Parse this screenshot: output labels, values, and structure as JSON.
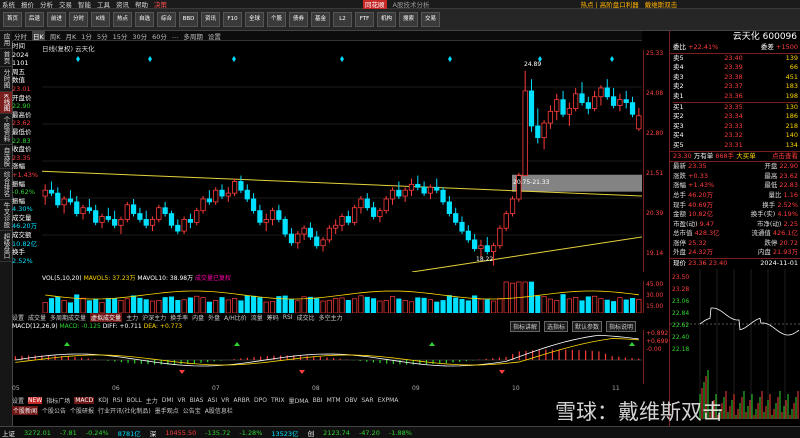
{
  "menu": [
    "系统",
    "报价",
    "分析",
    "交易",
    "智能",
    "工具",
    "资讯",
    "帮助",
    "决策"
  ],
  "app_logo": "同花顺",
  "menu_center": "A股技术分析",
  "menu_right": [
    "热点 | 高阶盘口利器",
    "戴维斯双击"
  ],
  "toolbar": [
    {
      "icon": "home-icon",
      "label": "首页"
    },
    {
      "icon": "back-icon",
      "label": "后退"
    },
    {
      "icon": "forward-icon",
      "label": "前进"
    },
    {
      "icon": "chart-icon",
      "label": "分时"
    },
    {
      "icon": "k-icon",
      "label": "K线"
    },
    {
      "icon": "hot-icon",
      "label": "热点"
    },
    {
      "icon": "select-icon",
      "label": "自选"
    },
    {
      "icon": "rank-icon",
      "label": "综合"
    },
    {
      "icon": "bbd-icon",
      "label": "BBD"
    },
    {
      "icon": "news-icon",
      "label": "资讯"
    },
    {
      "icon": "f10-icon",
      "label": "F10"
    },
    {
      "icon": "global-icon",
      "label": "全球"
    },
    {
      "icon": "stock-icon",
      "label": "个股"
    },
    {
      "icon": "bond-icon",
      "label": "债券"
    },
    {
      "icon": "fund-icon",
      "label": "基金"
    },
    {
      "icon": "level2-icon",
      "label": "L2"
    },
    {
      "icon": "ftf-icon",
      "label": "FTF"
    },
    {
      "icon": "inst-icon",
      "label": "机构"
    },
    {
      "icon": "search-icon",
      "label": "搜索"
    },
    {
      "icon": "trade-icon",
      "label": "交易"
    }
  ],
  "sidebar": [
    {
      "label": "应用",
      "sel": false
    },
    {
      "label": "首页",
      "sel": false
    },
    {
      "label": "分时图",
      "sel": false
    },
    {
      "label": "K线图",
      "sel": true
    },
    {
      "label": "个股资料",
      "sel": false
    },
    {
      "label": "自选股",
      "sel": false
    },
    {
      "label": "综合排名",
      "sel": false
    },
    {
      "label": "牛叉诊股",
      "sel": false
    },
    {
      "label": "超级盘口",
      "sel": false
    }
  ],
  "periods": [
    "分时",
    "日K",
    "周K",
    "月K",
    "1分",
    "5分",
    "15分",
    "30分",
    "60分",
    "…",
    "多周期",
    "设置"
  ],
  "period_selected": "日K",
  "main_title": "日线(复权)  云天化",
  "left_info": [
    {
      "t": "时间",
      "c": "wht"
    },
    {
      "t": "2024",
      "c": "wht"
    },
    {
      "t": "1101",
      "c": "wht"
    },
    {
      "t": "周五",
      "c": "wht"
    },
    {
      "t": "数值",
      "c": "wht"
    },
    {
      "t": "23.01",
      "c": "red"
    },
    {
      "t": "开盘价",
      "c": "wht"
    },
    {
      "t": "22.90",
      "c": "green"
    },
    {
      "t": "最高价",
      "c": "wht"
    },
    {
      "t": "23.62",
      "c": "red"
    },
    {
      "t": "最低价",
      "c": "wht"
    },
    {
      "t": "22.83",
      "c": "green"
    },
    {
      "t": "收盘价",
      "c": "wht"
    },
    {
      "t": "23.35",
      "c": "red"
    },
    {
      "t": "涨幅",
      "c": "wht"
    },
    {
      "t": "+1.43%",
      "c": "red"
    },
    {
      "t": "振幅",
      "c": "wht"
    },
    {
      "t": "-0.62%",
      "c": "green"
    },
    {
      "t": "振幅",
      "c": "wht"
    },
    {
      "t": "4.30%",
      "c": "cyan"
    },
    {
      "t": "成交量",
      "c": "wht"
    },
    {
      "t": "46.20万",
      "c": "cyan"
    },
    {
      "t": "成交额",
      "c": "wht"
    },
    {
      "t": "10.82亿",
      "c": "cyan"
    },
    {
      "t": "换手",
      "c": "wht"
    },
    {
      "t": "2.52%",
      "c": "cyan"
    }
  ],
  "price_axis": [
    "25.33",
    "24.08",
    "22.80",
    "21.51",
    "20.39",
    "19.14"
  ],
  "annotations": {
    "high": "24.89",
    "low": "18.22",
    "range": "20.75-21.33"
  },
  "volume_legend": {
    "name": "VOL(5,10,20)",
    "ma5": "MAVOL5: 37.23万",
    "ma10": "MAVOL10: 38.98万",
    "extra": "成交量已复权"
  },
  "volume_axis": [
    "45.00",
    "30.00",
    "15.00"
  ],
  "bottom_tabs": [
    "设置",
    "成交量",
    "多周期成交量",
    "虚拟成交量",
    "主力",
    "沪深主力",
    "换手率",
    "内盘",
    "外盘",
    "A/H比价",
    "流量",
    "筹码",
    "RSI",
    "成交比",
    "多空主力"
  ],
  "bottom_tab_selected": "虚拟成交量",
  "right_buttons": [
    "指标讲解",
    "选指标",
    "默认参数",
    "指标说明"
  ],
  "macd_legend": {
    "name": "MACD(12,26,9)",
    "macd": "MACD: -0.125",
    "diff": "DIFF: +0.711",
    "dea": "DEA: +0.773"
  },
  "macd_axis": [
    "+0.892",
    "+0.699",
    "-0.00"
  ],
  "months": [
    "05",
    "06",
    "07",
    "08",
    "09",
    "10",
    "11"
  ],
  "indicator_tabs": [
    "设置",
    "NEW",
    "指标广场",
    "MACD",
    "KDJ",
    "RSI",
    "BOLL",
    "主力",
    "DMI",
    "VR",
    "BIAS",
    "ASI",
    "VR",
    "ARBR",
    "DPO",
    "TRIX",
    "量DMA",
    "BBI",
    "MTM",
    "OBV",
    "SAR",
    "EXPMA"
  ],
  "indicator_selected": "MACD",
  "news_tabs": [
    "个股新闻",
    "个股公告",
    "个股研报",
    "行业开讯(社化制品)",
    "墨手观点",
    "公告宝",
    "A股信息栏"
  ],
  "news_selected": "个股新闻",
  "right_panel": {
    "title": "云天化  600096",
    "weibi": "委比",
    "weibi_val": "+22.41%",
    "weicha": "委差",
    "weicha_val": "+1500",
    "sell": [
      {
        "lv": "5",
        "p": "23.40",
        "v": "139"
      },
      {
        "lv": "4",
        "p": "23.39",
        "v": "66"
      },
      {
        "lv": "3",
        "p": "23.38",
        "v": "451"
      },
      {
        "lv": "2",
        "p": "23.37",
        "v": "183"
      },
      {
        "lv": "1",
        "p": "23.36",
        "v": "198"
      }
    ],
    "buy": [
      {
        "lv": "1",
        "p": "23.35",
        "v": "130"
      },
      {
        "lv": "2",
        "p": "23.34",
        "v": "186"
      },
      {
        "lv": "3",
        "p": "23.33",
        "v": "218"
      },
      {
        "lv": "4",
        "p": "23.32",
        "v": "140"
      },
      {
        "lv": "5",
        "p": "23.31",
        "v": "134"
      }
    ],
    "quote_head": {
      "price": "23.30",
      "text": "万有单",
      "big": "868手",
      "tag": "大买单",
      "link": "点击查看"
    },
    "quote": [
      {
        "k": "最新",
        "v": "23.35",
        "k2": "开盘",
        "v2": "22.90"
      },
      {
        "k": "涨跌",
        "v": "+0.33",
        "k2": "最高",
        "v2": "23.62"
      },
      {
        "k": "涨幅",
        "v": "+1.43%",
        "k2": "最低",
        "v2": "22.83"
      },
      {
        "k": "总手",
        "v": "46.20万",
        "k2": "量比",
        "v2": "1.16"
      },
      {
        "k": "现手",
        "v": "40.69万",
        "k2": "换手",
        "v2": "2.52%"
      },
      {
        "k": "金额",
        "v": "10.82亿",
        "k2": "换手(实)",
        "v2": "4.19%"
      },
      {
        "k": "市盈(动)",
        "v": "9.47",
        "k2": "市净(动)",
        "v2": "2.25"
      },
      {
        "k": "总市值",
        "v": "428.3亿",
        "k2": "流通值",
        "v2": "426.1亿"
      },
      {
        "k": "涨停",
        "v": "25.32",
        "k2": "跌停",
        "v2": "20.72"
      },
      {
        "k": "外盘",
        "v": "24.32万",
        "k2": "内盘",
        "v2": "21.93万"
      }
    ],
    "mini_head": {
      "k": "现价",
      "price": "23.36",
      "chg": "23.40",
      "date": "2024-11-01"
    },
    "mini_axis": [
      "23.50",
      "23.28",
      "23.06",
      "22.84",
      "22.62",
      "22.40",
      "22.18"
    ]
  },
  "statusbar": [
    {
      "t": "上证",
      "c": "wht"
    },
    {
      "t": "3272.01",
      "c": "green"
    },
    {
      "t": "-7.81",
      "c": "green"
    },
    {
      "t": "-0.24%",
      "c": "green"
    },
    {
      "t": "8781亿",
      "c": "cyan"
    },
    {
      "t": "深",
      "c": "wht"
    },
    {
      "t": "10455.50",
      "c": "red"
    },
    {
      "t": "-135.72",
      "c": "green"
    },
    {
      "t": "-1.28%",
      "c": "green"
    },
    {
      "t": "13523亿",
      "c": "cyan"
    },
    {
      "t": "创",
      "c": "wht"
    },
    {
      "t": "2123.74",
      "c": "green"
    },
    {
      "t": "-47.20",
      "c": "green"
    },
    {
      "t": "-1.88%",
      "c": "green"
    }
  ],
  "watermark": "雪球：戴维斯双击",
  "chart_data": {
    "type": "candlestick",
    "title": "日线(复权) 云天化",
    "yrange": [
      18.22,
      25.33
    ],
    "months": [
      "05",
      "06",
      "07",
      "08",
      "09",
      "10",
      "11"
    ],
    "candles_ohlc": [
      [
        20.6,
        21.0,
        20.3,
        20.8
      ],
      [
        20.8,
        21.1,
        20.6,
        20.7
      ],
      [
        20.7,
        20.9,
        20.2,
        20.3
      ],
      [
        20.3,
        20.6,
        20.0,
        20.5
      ],
      [
        20.5,
        20.8,
        20.3,
        20.4
      ],
      [
        20.4,
        20.6,
        19.9,
        20.0
      ],
      [
        20.0,
        20.3,
        19.8,
        20.2
      ],
      [
        20.2,
        20.5,
        20.0,
        20.1
      ],
      [
        20.1,
        20.3,
        19.6,
        19.7
      ],
      [
        19.7,
        20.0,
        19.5,
        19.9
      ],
      [
        19.9,
        20.2,
        19.7,
        19.8
      ],
      [
        19.8,
        20.1,
        19.5,
        19.6
      ],
      [
        19.6,
        19.9,
        19.3,
        19.8
      ],
      [
        19.8,
        20.4,
        19.7,
        20.3
      ],
      [
        20.3,
        20.5,
        19.9,
        20.0
      ],
      [
        20.0,
        20.2,
        19.7,
        19.8
      ],
      [
        19.8,
        20.1,
        19.5,
        19.6
      ],
      [
        19.6,
        19.9,
        19.4,
        19.8
      ],
      [
        19.8,
        20.3,
        19.7,
        20.2
      ],
      [
        20.2,
        20.4,
        19.9,
        20.0
      ],
      [
        20.0,
        20.1,
        19.5,
        19.6
      ],
      [
        19.6,
        19.8,
        19.3,
        19.4
      ],
      [
        19.4,
        19.9,
        19.3,
        19.8
      ],
      [
        19.8,
        20.0,
        19.5,
        19.7
      ],
      [
        19.7,
        20.2,
        19.6,
        20.1
      ],
      [
        20.1,
        20.6,
        20.0,
        20.5
      ],
      [
        20.5,
        20.8,
        20.3,
        20.4
      ],
      [
        20.4,
        20.9,
        20.3,
        20.8
      ],
      [
        20.8,
        21.0,
        20.5,
        20.6
      ],
      [
        20.6,
        20.9,
        20.4,
        20.7
      ],
      [
        20.7,
        21.2,
        20.6,
        21.1
      ],
      [
        21.1,
        21.3,
        20.7,
        20.8
      ],
      [
        20.8,
        21.0,
        20.4,
        20.5
      ],
      [
        20.5,
        20.7,
        20.0,
        20.1
      ],
      [
        20.1,
        20.3,
        19.6,
        19.7
      ],
      [
        19.7,
        20.0,
        19.4,
        19.8
      ],
      [
        19.8,
        20.2,
        19.6,
        20.1
      ],
      [
        20.1,
        20.3,
        19.7,
        19.8
      ],
      [
        19.8,
        19.9,
        19.2,
        19.3
      ],
      [
        19.3,
        19.5,
        18.9,
        19.0
      ],
      [
        19.0,
        19.4,
        18.8,
        19.3
      ],
      [
        19.3,
        19.6,
        19.1,
        19.5
      ],
      [
        19.5,
        19.7,
        19.1,
        19.2
      ],
      [
        19.2,
        19.4,
        18.8,
        18.9
      ],
      [
        18.9,
        19.2,
        18.7,
        19.1
      ],
      [
        19.1,
        19.6,
        19.0,
        19.5
      ],
      [
        19.5,
        19.8,
        19.3,
        19.6
      ],
      [
        19.6,
        20.0,
        19.4,
        19.9
      ],
      [
        19.9,
        20.1,
        19.6,
        19.7
      ],
      [
        19.7,
        20.3,
        19.6,
        20.2
      ],
      [
        20.2,
        20.6,
        20.0,
        20.5
      ],
      [
        20.5,
        20.7,
        20.1,
        20.2
      ],
      [
        20.2,
        20.4,
        19.8,
        19.9
      ],
      [
        19.9,
        20.2,
        19.7,
        20.1
      ],
      [
        20.1,
        20.6,
        20.0,
        20.5
      ],
      [
        20.5,
        20.9,
        20.3,
        20.8
      ],
      [
        20.8,
        21.1,
        20.5,
        20.6
      ],
      [
        20.6,
        20.9,
        20.4,
        20.8
      ],
      [
        20.8,
        21.2,
        20.6,
        21.0
      ],
      [
        21.0,
        21.3,
        20.8,
        20.9
      ],
      [
        20.9,
        21.1,
        20.6,
        20.7
      ],
      [
        20.7,
        21.0,
        20.5,
        20.9
      ],
      [
        20.9,
        21.2,
        20.7,
        20.8
      ],
      [
        20.8,
        20.9,
        20.3,
        20.4
      ],
      [
        20.4,
        20.6,
        19.9,
        20.0
      ],
      [
        20.0,
        20.2,
        19.6,
        19.7
      ],
      [
        19.7,
        19.9,
        19.3,
        19.4
      ],
      [
        19.4,
        19.6,
        19.0,
        19.1
      ],
      [
        19.1,
        19.3,
        18.7,
        18.8
      ],
      [
        18.8,
        19.1,
        18.5,
        18.9
      ],
      [
        18.9,
        19.2,
        18.6,
        18.7
      ],
      [
        18.7,
        19.0,
        18.22,
        18.9
      ],
      [
        18.9,
        19.6,
        18.8,
        19.5
      ],
      [
        19.5,
        20.1,
        19.4,
        20.0
      ],
      [
        20.0,
        20.6,
        19.9,
        20.5
      ],
      [
        20.5,
        21.4,
        20.4,
        21.3
      ],
      [
        21.3,
        24.89,
        21.3,
        24.2
      ],
      [
        24.2,
        24.6,
        22.8,
        23.0
      ],
      [
        23.0,
        23.6,
        22.4,
        22.6
      ],
      [
        22.6,
        23.2,
        22.2,
        23.1
      ],
      [
        23.1,
        23.7,
        22.9,
        23.5
      ],
      [
        23.5,
        24.1,
        23.2,
        23.9
      ],
      [
        23.9,
        24.2,
        23.3,
        23.4
      ],
      [
        23.4,
        23.8,
        23.0,
        23.6
      ],
      [
        23.6,
        24.3,
        23.5,
        24.1
      ],
      [
        24.1,
        24.5,
        23.7,
        23.8
      ],
      [
        23.8,
        24.0,
        23.4,
        23.6
      ],
      [
        23.6,
        24.2,
        23.5,
        24.0
      ],
      [
        24.0,
        24.4,
        23.7,
        24.3
      ],
      [
        24.3,
        24.6,
        23.9,
        24.0
      ],
      [
        24.0,
        24.3,
        23.6,
        23.7
      ],
      [
        23.7,
        24.1,
        23.5,
        23.9
      ],
      [
        23.9,
        24.2,
        23.6,
        23.8
      ],
      [
        23.8,
        24.0,
        23.3,
        23.4
      ],
      [
        22.9,
        23.62,
        22.83,
        23.35
      ]
    ],
    "volume_max": 45,
    "macd_range": [
      -0.9,
      0.9
    ]
  }
}
